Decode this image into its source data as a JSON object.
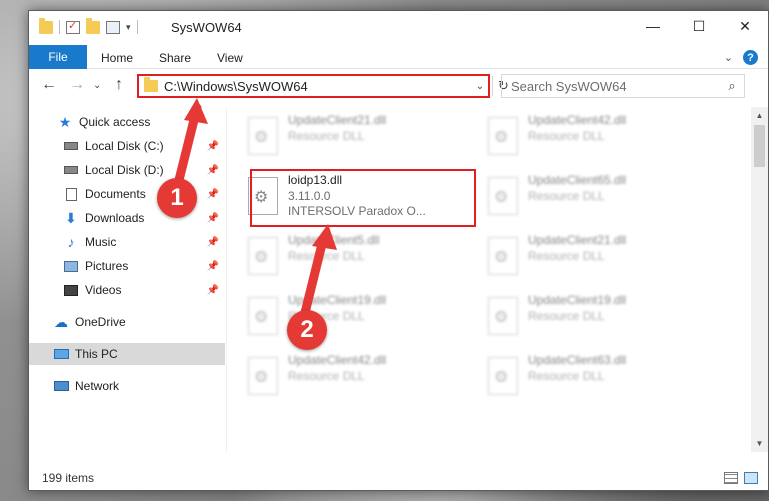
{
  "window": {
    "title": "SysWOW64",
    "controls": {
      "minimize": "—",
      "maximize": "☐",
      "close": "✕"
    }
  },
  "ribbon": {
    "tabs": [
      "File",
      "Home",
      "Share",
      "View"
    ],
    "help": "?",
    "expand": "⌄"
  },
  "navigation": {
    "back": "←",
    "forward": "→",
    "recent": "⌄",
    "up": "↑",
    "address": "C:\\Windows\\SysWOW64",
    "address_dropdown": "⌄",
    "refresh": "↻",
    "search_placeholder": "Search SysWOW64",
    "search_icon": "⌕"
  },
  "nav_pane": {
    "items": [
      {
        "label": "Quick access",
        "icon": "star-icon",
        "pinned": false
      },
      {
        "label": "Local Disk (C:)",
        "icon": "drive-icon",
        "pinned": true
      },
      {
        "label": "Local Disk (D:)",
        "icon": "drive-icon",
        "pinned": true
      },
      {
        "label": "Documents",
        "icon": "documents-icon",
        "pinned": true
      },
      {
        "label": "Downloads",
        "icon": "download-icon",
        "pinned": true
      },
      {
        "label": "Music",
        "icon": "music-icon",
        "pinned": true
      },
      {
        "label": "Pictures",
        "icon": "pictures-icon",
        "pinned": true
      },
      {
        "label": "Videos",
        "icon": "videos-icon",
        "pinned": true
      },
      {
        "label": "OneDrive",
        "icon": "onedrive-icon",
        "pinned": false
      },
      {
        "label": "This PC",
        "icon": "this-pc-icon",
        "pinned": false,
        "selected": true
      },
      {
        "label": "Network",
        "icon": "network-icon",
        "pinned": false
      }
    ],
    "pin_glyph": "📌",
    "glyphs": {
      "star": "★",
      "download": "⬇",
      "music": "♪",
      "onedrive": "☁"
    }
  },
  "files": {
    "left_column": [
      {
        "name": "UpdateClient21.dll",
        "sub": "Resource DLL",
        "blurred": true
      },
      {
        "name": "loidp13.dll",
        "sub": "3.11.0.0",
        "sub2": "INTERSOLV Paradox O...",
        "blurred": false,
        "highlighted": true
      },
      {
        "name": "UpdateClient5.dll",
        "sub": "Resource DLL",
        "blurred": true
      },
      {
        "name": "UpdateClient19.dll",
        "sub": "Resource DLL",
        "blurred": true
      },
      {
        "name": "UpdateClient42.dll",
        "sub": "Resource DLL",
        "blurred": true
      }
    ],
    "right_column": [
      {
        "name": "UpdateClient42.dll",
        "sub": "Resource DLL"
      },
      {
        "name": "UpdateClient65.dll",
        "sub": "Resource DLL"
      },
      {
        "name": "UpdateClient21.dll",
        "sub": "Resource DLL"
      },
      {
        "name": "UpdateClient19.dll",
        "sub": "Resource DLL"
      },
      {
        "name": "UpdateClient63.dll",
        "sub": "Resource DLL"
      }
    ]
  },
  "status": {
    "item_count": "199 items"
  },
  "annotations": {
    "marker1": "1",
    "marker2": "2",
    "accent": "#e53935"
  },
  "colors": {
    "file_tab": "#1979ca",
    "highlight": "#e02020",
    "selected": "#d9d9d9"
  }
}
